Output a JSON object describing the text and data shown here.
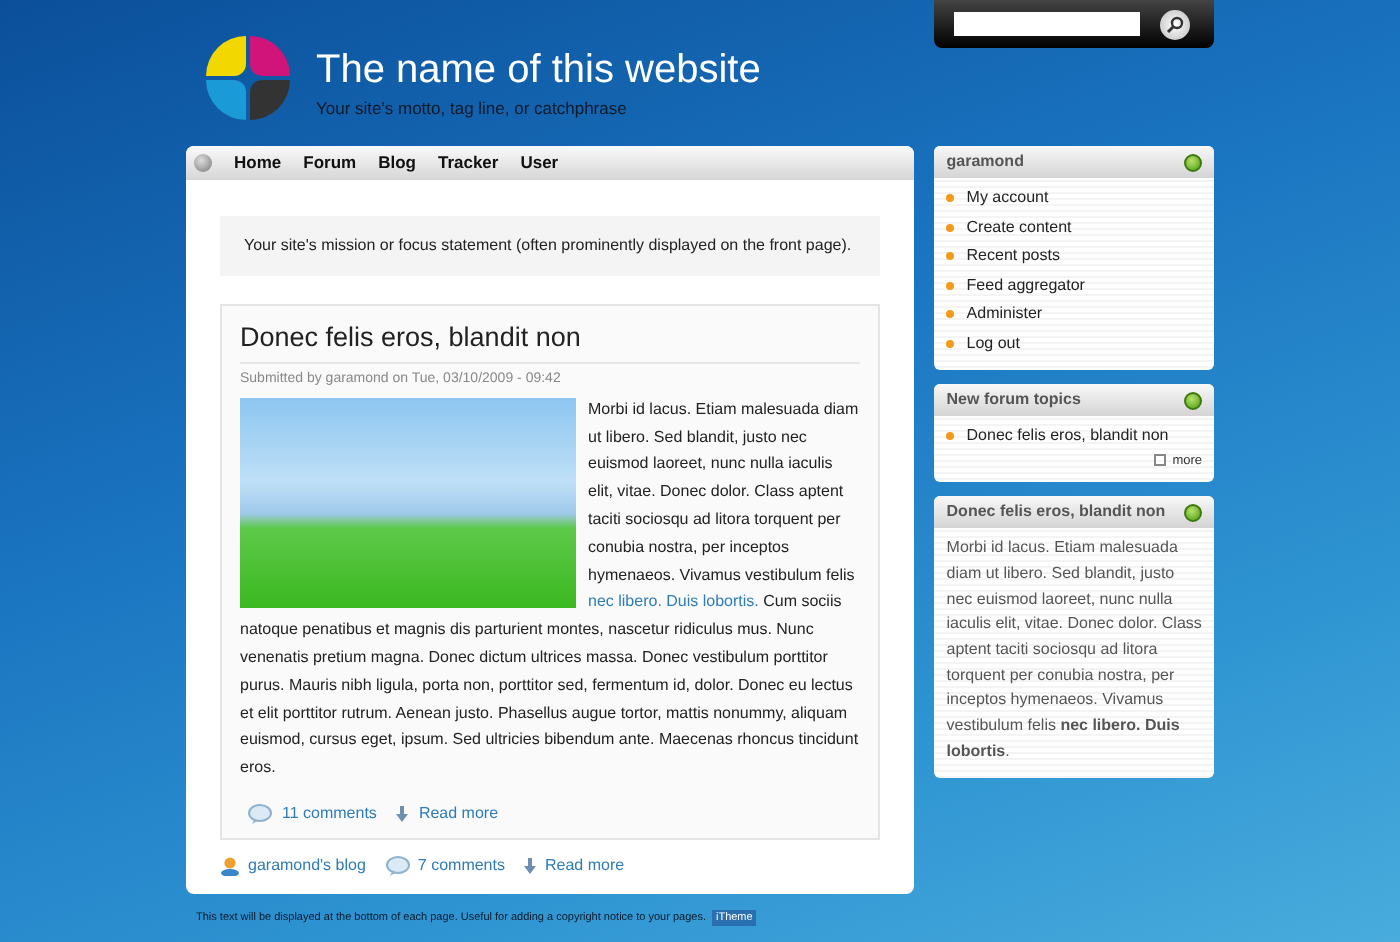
{
  "site": {
    "title": "The name of this website",
    "slogan": "Your site's motto, tag line, or catchphrase"
  },
  "nav": [
    "Home",
    "Forum",
    "Blog",
    "Tracker",
    "User"
  ],
  "mission": "Your site's mission or focus statement (often prominently displayed on the front page).",
  "article": {
    "title": "Donec felis eros, blandit non",
    "submitted": "Submitted by garamond on Tue, 03/10/2009 - 09:42",
    "body_before_link": "Morbi id lacus. Etiam malesuada diam ut libero. Sed blandit, justo nec euismod laoreet, nunc nulla iaculis elit, vitae. Donec dolor. Class aptent taciti sociosqu ad litora torquent per conubia nostra, per inceptos hymenaeos. Vivamus vestibulum felis",
    "link": "nec libero. Duis lobortis.",
    "body_after_link": "Cum sociis natoque penatibus et magnis dis parturient montes, nascetur ridiculus mus. Nunc venenatis pretium magna. Donec dictum ultrices massa. Donec vestibulum porttitor purus. Mauris nibh ligula, porta non, porttitor sed, fermentum id, dolor. Donec eu lectus et elit porttitor rutrum. Aenean justo. Phasellus augue tortor, mattis nonummy, aliquam euismod, cursus eget, ipsum. Sed ultricies bibendum ante. Maecenas rhoncus tincidunt eros.",
    "links": [
      {
        "kind": "comments",
        "label": "11 comments"
      },
      {
        "kind": "readmore",
        "label": "Read more"
      }
    ]
  },
  "post_links": [
    {
      "kind": "blog",
      "label": "garamond's blog"
    },
    {
      "kind": "comments",
      "label": "7 comments"
    },
    {
      "kind": "readmore",
      "label": "Read more"
    }
  ],
  "blocks": [
    {
      "kind": "list",
      "title": "garamond",
      "items": [
        "My account",
        "Create content",
        "Recent posts",
        "Feed aggregator",
        "Administer",
        "Log out"
      ]
    },
    {
      "kind": "list",
      "title": "New forum topics",
      "items": [
        "Donec felis eros, blandit non"
      ],
      "more": "more"
    },
    {
      "kind": "text",
      "title": "Donec felis eros, blandit non",
      "text": "Morbi id lacus. Etiam malesuada diam ut libero. Sed blandit, justo nec euismod laoreet, nunc nulla iaculis elit, vitae. Donec dolor. Class aptent taciti sociosqu ad litora torquent per conubia nostra, per inceptos hymenaeos. Vivamus vestibulum felis **nec libero. Duis lobortis**."
    }
  ],
  "footer": {
    "text": "This text will be displayed at the bottom of each page. Useful for adding a copyright notice to your pages.",
    "badge": "iTheme"
  }
}
